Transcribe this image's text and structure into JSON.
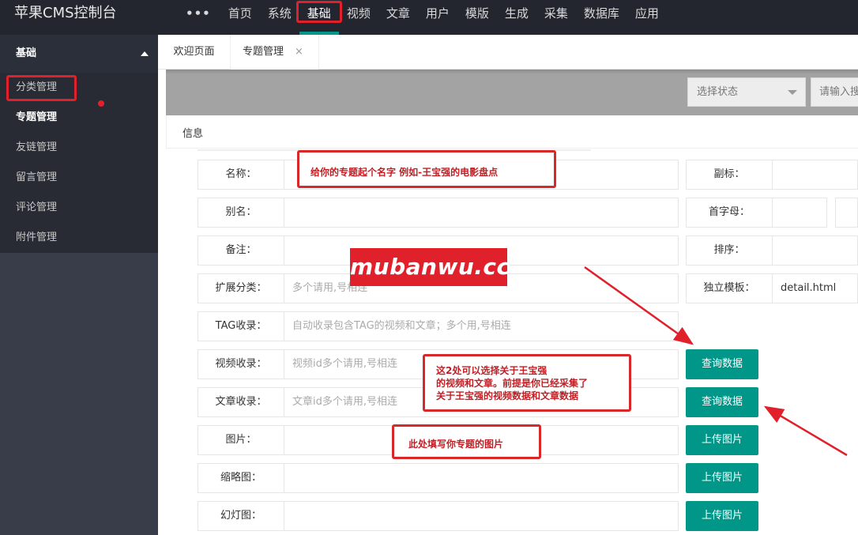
{
  "app": {
    "title": "苹果CMS控制台"
  },
  "topnav": {
    "more": "•••",
    "items": [
      "首页",
      "系统",
      "基础",
      "视频",
      "文章",
      "用户",
      "模版",
      "生成",
      "采集",
      "数据库",
      "应用"
    ],
    "active": "基础"
  },
  "sidebar": {
    "group": "基础",
    "items": [
      "分类管理",
      "专题管理",
      "友链管理",
      "留言管理",
      "评论管理",
      "附件管理"
    ],
    "current": "专题管理"
  },
  "tabs": {
    "welcome": "欢迎页面",
    "topic": "专题管理",
    "close": "×"
  },
  "toolbar": {
    "status_placeholder": "选择状态",
    "search_placeholder": "请输入搜"
  },
  "panel": {
    "title": "信息"
  },
  "form": {
    "name": {
      "label": "名称：",
      "value": ""
    },
    "alias": {
      "label": "别名：",
      "value": ""
    },
    "remark": {
      "label": "备注：",
      "value": ""
    },
    "ext_type": {
      "label": "扩展分类：",
      "placeholder": "多个请用,号相连"
    },
    "tag": {
      "label": "TAG收录：",
      "placeholder": "自动收录包含TAG的视频和文章；多个用,号相连"
    },
    "video": {
      "label": "视频收录：",
      "placeholder": "视频id多个请用,号相连"
    },
    "article": {
      "label": "文章收录：",
      "placeholder": "文章id多个请用,号相连"
    },
    "pic": {
      "label": "图片：",
      "value": ""
    },
    "thumb": {
      "label": "缩略图：",
      "value": ""
    },
    "slide": {
      "label": "幻灯图：",
      "value": ""
    },
    "sub": {
      "label": "副标：",
      "value": ""
    },
    "letter": {
      "label": "首字母：",
      "value": ""
    },
    "sort": {
      "label": "排序：",
      "value": ""
    },
    "tpl": {
      "label": "独立模板：",
      "value": "detail.html"
    }
  },
  "buttons": {
    "query_video": "查询数据",
    "query_article": "查询数据",
    "upload_pic": "上传图片",
    "upload_thumb": "上传图片",
    "upload_slide": "上传图片"
  },
  "annotations": {
    "name_tip": "给你的专题起个名字 例如-王宝强的电影盘点",
    "watermark": "mubanwu.cc",
    "collect_tip_1": "这2处可以选择关于王宝强",
    "collect_tip_2": "的视频和文章。前提是你已经采集了",
    "collect_tip_3": "关于王宝强的视频数据和文章数据",
    "pic_tip": "此处填写你专题的图片"
  },
  "colors": {
    "topbar": "#23262e",
    "sidebar": "#393d49",
    "accent": "#009688",
    "annotation_red": "#e0212b"
  }
}
